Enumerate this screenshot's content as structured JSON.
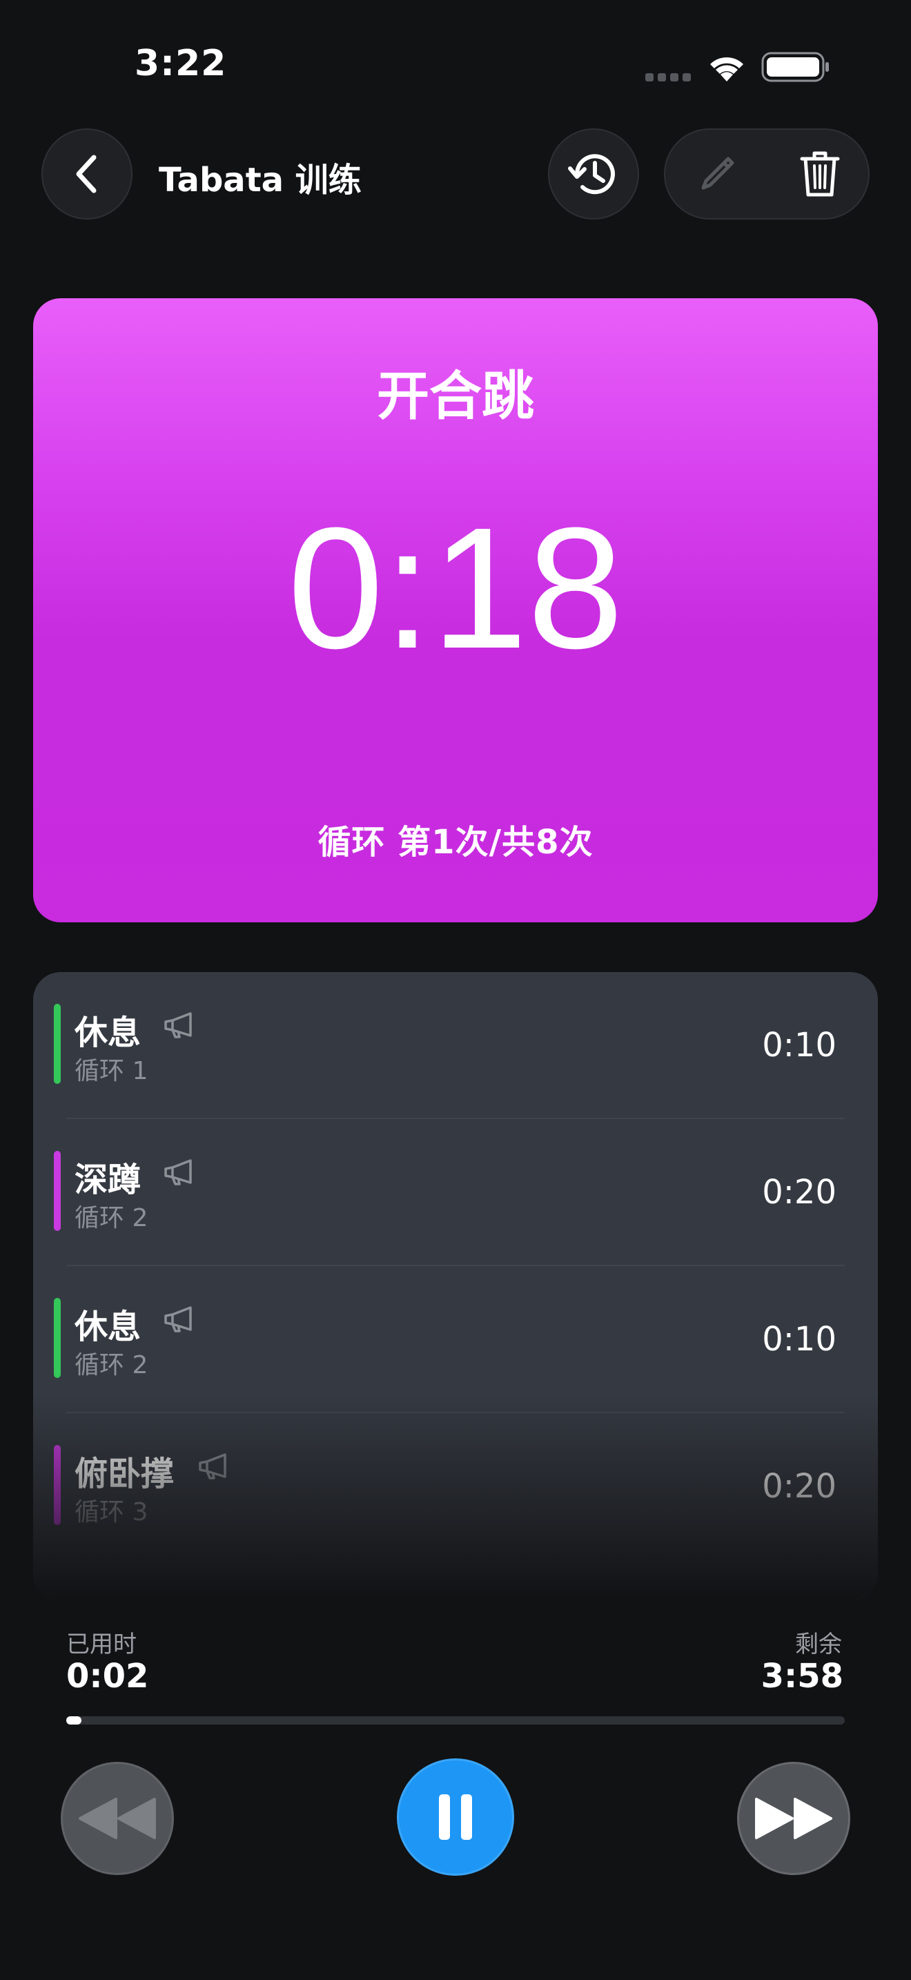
{
  "status_bar": {
    "time": "3:22"
  },
  "nav": {
    "title": "Tabata 训练"
  },
  "current": {
    "exercise": "开合跳",
    "time": "0:18",
    "round": "循环 第1次/共8次",
    "color": "#d640ee"
  },
  "queue": [
    {
      "name": "休息",
      "round": "循环 1",
      "duration": "0:10",
      "color": "#34c759"
    },
    {
      "name": "深蹲",
      "round": "循环 2",
      "duration": "0:20",
      "color": "#c93ae0"
    },
    {
      "name": "休息",
      "round": "循环 2",
      "duration": "0:10",
      "color": "#34c759"
    },
    {
      "name": "俯卧撑",
      "round": "循环 3",
      "duration": "0:20",
      "color": "#c93ae0"
    }
  ],
  "progress": {
    "elapsed_label": "已用时",
    "elapsed": "0:02",
    "remaining_label": "剩余",
    "remaining": "3:58",
    "fraction": 0.008
  },
  "icons": {
    "back": "chevron-left-icon",
    "history": "history-icon",
    "edit": "pencil-icon",
    "delete": "trash-icon",
    "speaker": "megaphone-icon",
    "rewind": "rewind-icon",
    "pause": "pause-icon",
    "forward": "fast-forward-icon"
  }
}
